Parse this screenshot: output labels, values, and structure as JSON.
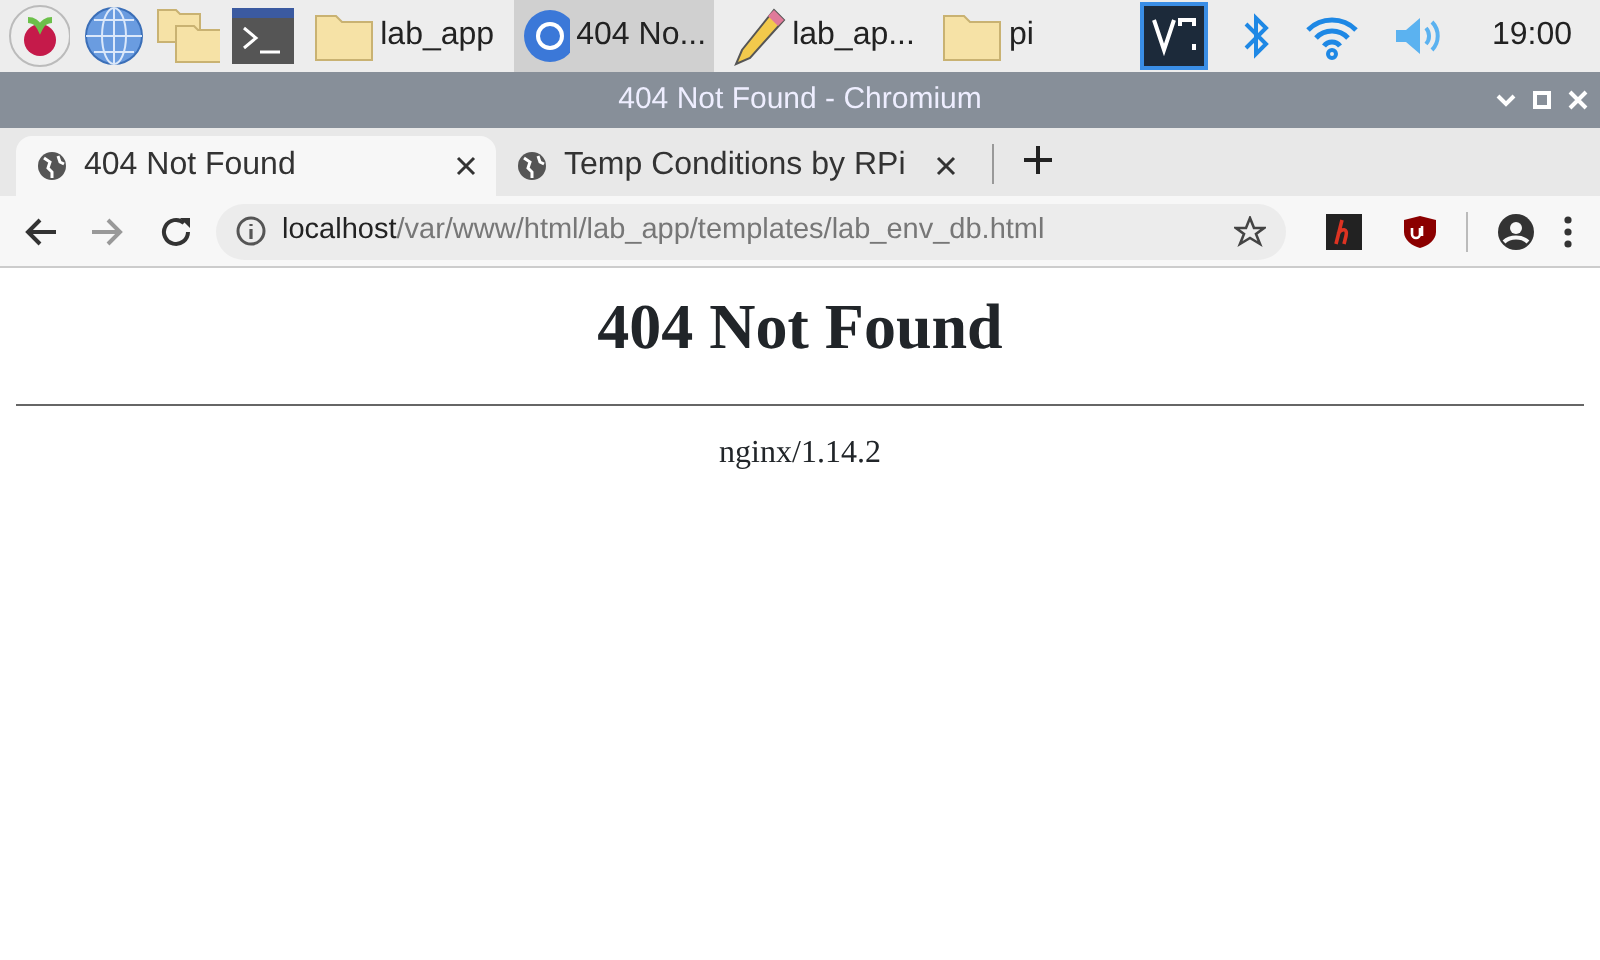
{
  "taskbar": {
    "tasks": [
      {
        "kind": "folder",
        "label": "lab_app",
        "selected": false
      },
      {
        "kind": "browser",
        "label": "404 No...",
        "selected": true
      },
      {
        "kind": "editor",
        "label": "lab_ap...",
        "selected": false
      },
      {
        "kind": "folder",
        "label": "pi",
        "selected": false
      }
    ],
    "clock": "19:00"
  },
  "window": {
    "title": "404 Not Found - Chromium"
  },
  "tabs": [
    {
      "title": "404 Not Found",
      "selected": true
    },
    {
      "title": "Temp Conditions by RPi",
      "selected": false
    }
  ],
  "toolbar": {
    "back_disabled": false,
    "forward_disabled": true,
    "url_host": "localhost",
    "url_path": "/var/www/html/lab_app/templates/lab_env_db.html"
  },
  "page": {
    "heading": "404 Not Found",
    "server": "nginx/1.14.2"
  }
}
